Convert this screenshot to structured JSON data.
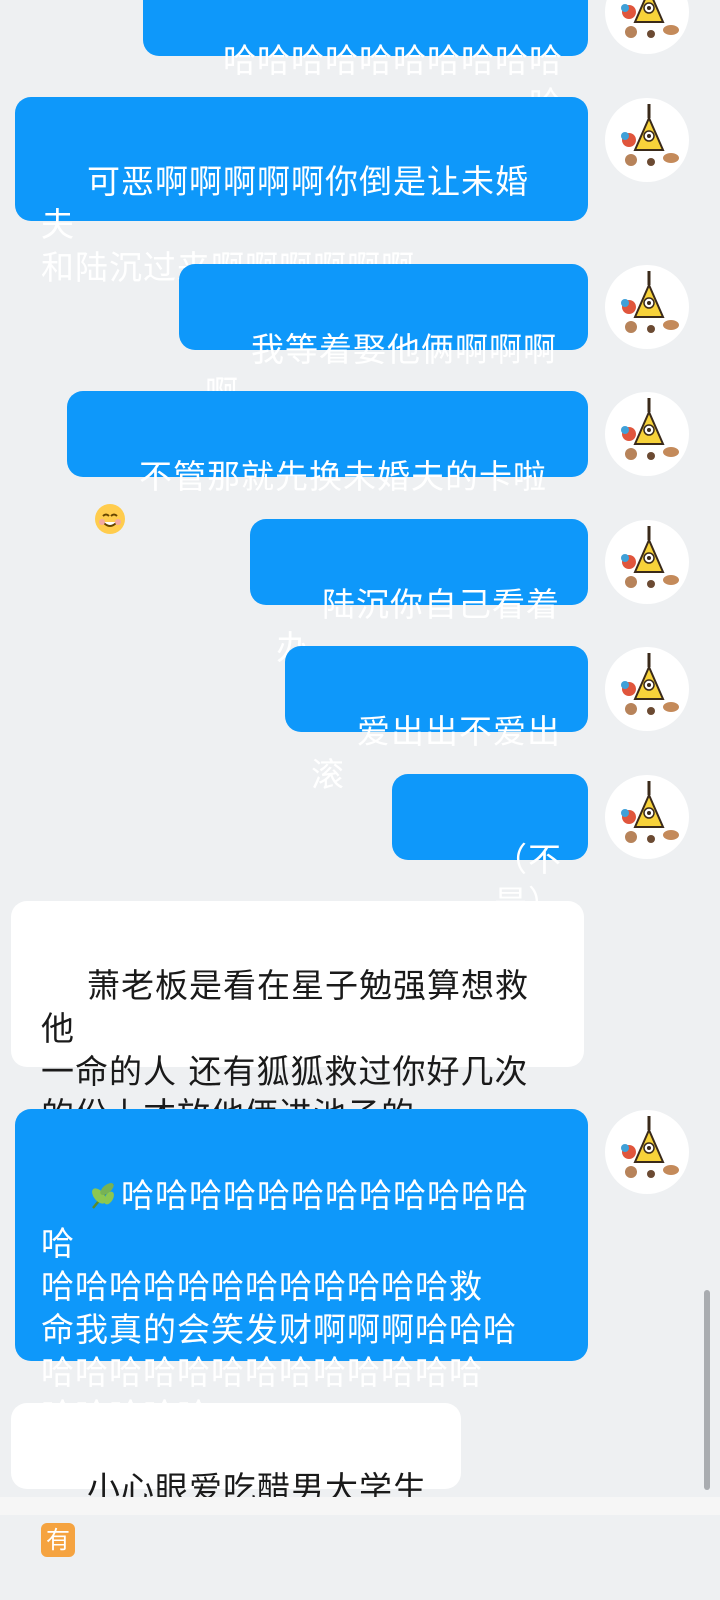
{
  "messages": [
    {
      "id": "m0",
      "side": "outgoing",
      "text": "哈哈哈哈哈哈哈哈哈哈哈",
      "emoji_suffix": null
    },
    {
      "id": "m1",
      "side": "outgoing",
      "text": "可恶啊啊啊啊啊你倒是让未婚夫\n和陆沉过来啊啊啊啊啊啊",
      "emoji_suffix": null
    },
    {
      "id": "m2",
      "side": "outgoing",
      "text": "我等着娶他俩啊啊啊啊",
      "emoji_suffix": null
    },
    {
      "id": "m3",
      "side": "outgoing",
      "text": "不管那就先换未婚夫的卡啦",
      "emoji_suffix": "smiling-face-emoji"
    },
    {
      "id": "m4",
      "side": "outgoing",
      "text": "陆沉你自己看着办",
      "emoji_suffix": null
    },
    {
      "id": "m5",
      "side": "outgoing",
      "text": "爱出出不爱出滚",
      "emoji_suffix": null
    },
    {
      "id": "m6",
      "side": "outgoing",
      "text": "（不是）",
      "emoji_suffix": null
    },
    {
      "id": "m7",
      "side": "incoming",
      "text": "萧老板是看在星子勉强算想救他\n一命的人 还有狐狐救过你好几次\n的份上才放他俩进池子的",
      "emoji_suffix": null
    },
    {
      "id": "m8",
      "side": "outgoing",
      "emoji_prefix": "herb-emoji",
      "text": "哈哈哈哈哈哈哈哈哈哈哈哈哈\n哈哈哈哈哈哈哈哈哈哈哈哈救\n命我真的会笑发财啊啊啊哈哈哈\n哈哈哈哈哈哈哈哈哈哈哈哈哈\n哈哈哈哈哈",
      "emoji_suffix": null
    },
    {
      "id": "m9",
      "side": "incoming",
      "text": "小心眼爱吃醋男大学生",
      "emoji_suffix": "you-badge-emoji",
      "badge_text": "有"
    }
  ],
  "avatar_icon": "triangle-character-avatar-icon",
  "colors": {
    "outgoing_bubble": "#0e98fa",
    "incoming_bubble": "#ffffff",
    "background": "#eef0f2"
  }
}
